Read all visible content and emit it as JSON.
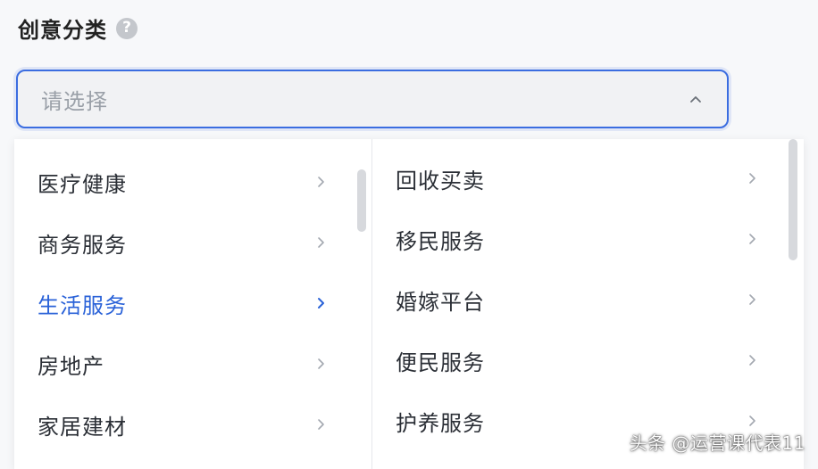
{
  "field": {
    "label": "创意分类",
    "help_icon": "question-circle-icon",
    "help_glyph": "?"
  },
  "select": {
    "placeholder": "请选择",
    "chevron_icon": "chevron-up-icon"
  },
  "dropdown": {
    "left_column": [
      {
        "label": "医疗健康",
        "active": false
      },
      {
        "label": "商务服务",
        "active": false
      },
      {
        "label": "生活服务",
        "active": true
      },
      {
        "label": "房地产",
        "active": false
      },
      {
        "label": "家居建材",
        "active": false
      }
    ],
    "right_column": [
      {
        "label": "回收买卖"
      },
      {
        "label": "移民服务"
      },
      {
        "label": "婚嫁平台"
      },
      {
        "label": "便民服务"
      },
      {
        "label": "护养服务"
      }
    ],
    "item_arrow_icon": "chevron-right-icon"
  },
  "watermark": {
    "text": "头条 @运营课代表11"
  },
  "colors": {
    "accent": "#2a62d8",
    "border_focus": "#3b6de0",
    "text": "#2b2f36",
    "placeholder": "#9aa0a8",
    "arrow": "#a3a8b0"
  }
}
